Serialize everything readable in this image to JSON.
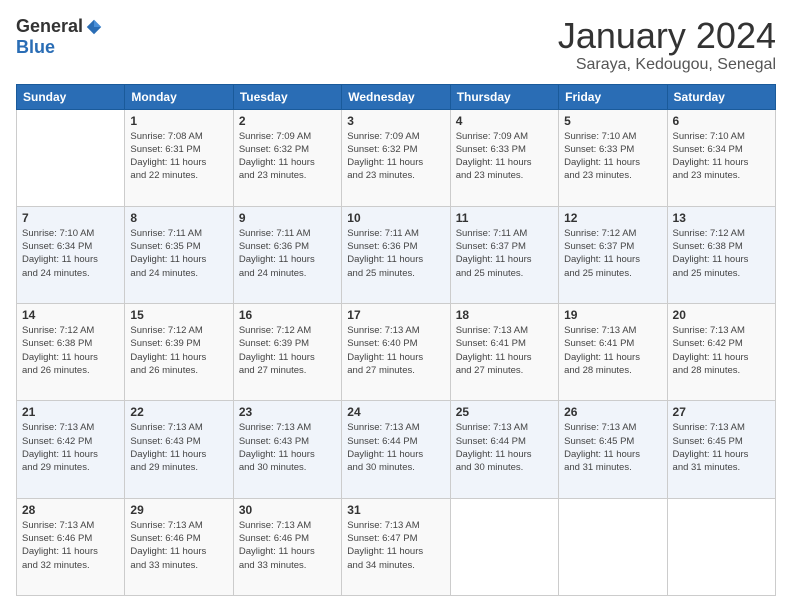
{
  "logo": {
    "general": "General",
    "blue": "Blue"
  },
  "title": "January 2024",
  "subtitle": "Saraya, Kedougou, Senegal",
  "headers": [
    "Sunday",
    "Monday",
    "Tuesday",
    "Wednesday",
    "Thursday",
    "Friday",
    "Saturday"
  ],
  "weeks": [
    [
      {
        "day": "",
        "info": ""
      },
      {
        "day": "1",
        "info": "Sunrise: 7:08 AM\nSunset: 6:31 PM\nDaylight: 11 hours\nand 22 minutes."
      },
      {
        "day": "2",
        "info": "Sunrise: 7:09 AM\nSunset: 6:32 PM\nDaylight: 11 hours\nand 23 minutes."
      },
      {
        "day": "3",
        "info": "Sunrise: 7:09 AM\nSunset: 6:32 PM\nDaylight: 11 hours\nand 23 minutes."
      },
      {
        "day": "4",
        "info": "Sunrise: 7:09 AM\nSunset: 6:33 PM\nDaylight: 11 hours\nand 23 minutes."
      },
      {
        "day": "5",
        "info": "Sunrise: 7:10 AM\nSunset: 6:33 PM\nDaylight: 11 hours\nand 23 minutes."
      },
      {
        "day": "6",
        "info": "Sunrise: 7:10 AM\nSunset: 6:34 PM\nDaylight: 11 hours\nand 23 minutes."
      }
    ],
    [
      {
        "day": "7",
        "info": "Sunrise: 7:10 AM\nSunset: 6:34 PM\nDaylight: 11 hours\nand 24 minutes."
      },
      {
        "day": "8",
        "info": "Sunrise: 7:11 AM\nSunset: 6:35 PM\nDaylight: 11 hours\nand 24 minutes."
      },
      {
        "day": "9",
        "info": "Sunrise: 7:11 AM\nSunset: 6:36 PM\nDaylight: 11 hours\nand 24 minutes."
      },
      {
        "day": "10",
        "info": "Sunrise: 7:11 AM\nSunset: 6:36 PM\nDaylight: 11 hours\nand 25 minutes."
      },
      {
        "day": "11",
        "info": "Sunrise: 7:11 AM\nSunset: 6:37 PM\nDaylight: 11 hours\nand 25 minutes."
      },
      {
        "day": "12",
        "info": "Sunrise: 7:12 AM\nSunset: 6:37 PM\nDaylight: 11 hours\nand 25 minutes."
      },
      {
        "day": "13",
        "info": "Sunrise: 7:12 AM\nSunset: 6:38 PM\nDaylight: 11 hours\nand 25 minutes."
      }
    ],
    [
      {
        "day": "14",
        "info": "Sunrise: 7:12 AM\nSunset: 6:38 PM\nDaylight: 11 hours\nand 26 minutes."
      },
      {
        "day": "15",
        "info": "Sunrise: 7:12 AM\nSunset: 6:39 PM\nDaylight: 11 hours\nand 26 minutes."
      },
      {
        "day": "16",
        "info": "Sunrise: 7:12 AM\nSunset: 6:39 PM\nDaylight: 11 hours\nand 27 minutes."
      },
      {
        "day": "17",
        "info": "Sunrise: 7:13 AM\nSunset: 6:40 PM\nDaylight: 11 hours\nand 27 minutes."
      },
      {
        "day": "18",
        "info": "Sunrise: 7:13 AM\nSunset: 6:41 PM\nDaylight: 11 hours\nand 27 minutes."
      },
      {
        "day": "19",
        "info": "Sunrise: 7:13 AM\nSunset: 6:41 PM\nDaylight: 11 hours\nand 28 minutes."
      },
      {
        "day": "20",
        "info": "Sunrise: 7:13 AM\nSunset: 6:42 PM\nDaylight: 11 hours\nand 28 minutes."
      }
    ],
    [
      {
        "day": "21",
        "info": "Sunrise: 7:13 AM\nSunset: 6:42 PM\nDaylight: 11 hours\nand 29 minutes."
      },
      {
        "day": "22",
        "info": "Sunrise: 7:13 AM\nSunset: 6:43 PM\nDaylight: 11 hours\nand 29 minutes."
      },
      {
        "day": "23",
        "info": "Sunrise: 7:13 AM\nSunset: 6:43 PM\nDaylight: 11 hours\nand 30 minutes."
      },
      {
        "day": "24",
        "info": "Sunrise: 7:13 AM\nSunset: 6:44 PM\nDaylight: 11 hours\nand 30 minutes."
      },
      {
        "day": "25",
        "info": "Sunrise: 7:13 AM\nSunset: 6:44 PM\nDaylight: 11 hours\nand 30 minutes."
      },
      {
        "day": "26",
        "info": "Sunrise: 7:13 AM\nSunset: 6:45 PM\nDaylight: 11 hours\nand 31 minutes."
      },
      {
        "day": "27",
        "info": "Sunrise: 7:13 AM\nSunset: 6:45 PM\nDaylight: 11 hours\nand 31 minutes."
      }
    ],
    [
      {
        "day": "28",
        "info": "Sunrise: 7:13 AM\nSunset: 6:46 PM\nDaylight: 11 hours\nand 32 minutes."
      },
      {
        "day": "29",
        "info": "Sunrise: 7:13 AM\nSunset: 6:46 PM\nDaylight: 11 hours\nand 33 minutes."
      },
      {
        "day": "30",
        "info": "Sunrise: 7:13 AM\nSunset: 6:46 PM\nDaylight: 11 hours\nand 33 minutes."
      },
      {
        "day": "31",
        "info": "Sunrise: 7:13 AM\nSunset: 6:47 PM\nDaylight: 11 hours\nand 34 minutes."
      },
      {
        "day": "",
        "info": ""
      },
      {
        "day": "",
        "info": ""
      },
      {
        "day": "",
        "info": ""
      }
    ]
  ]
}
